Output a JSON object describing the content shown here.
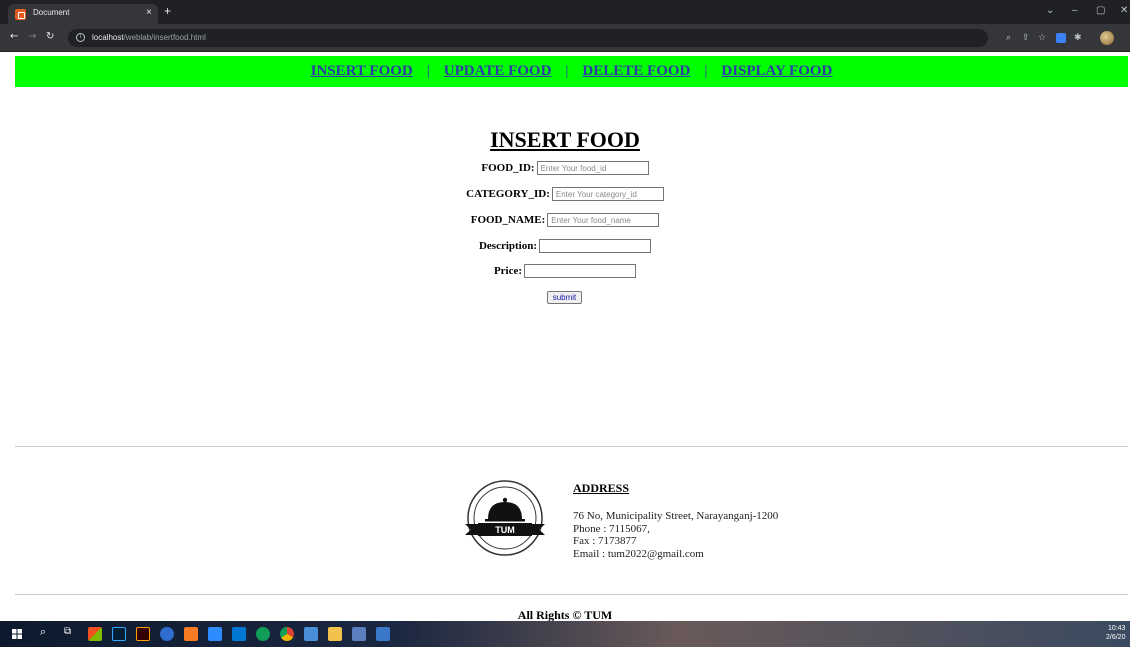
{
  "browser": {
    "tab_title": "Document",
    "tab_close": "×",
    "new_tab": "+",
    "url_host": "localhost",
    "url_path": "/weblab/insertfood.html",
    "window_controls": [
      "⌄",
      "–",
      "▢",
      "✕"
    ]
  },
  "navbar": {
    "links": [
      "INSERT FOOD",
      "UPDATE FOOD",
      "DELETE FOOD",
      "DISPLAY FOOD"
    ],
    "separator": "|"
  },
  "form": {
    "title": "INSERT FOOD",
    "fields": [
      {
        "label": "FOOD_ID:",
        "placeholder": "Enter Your food_id",
        "value": ""
      },
      {
        "label": "CATEGORY_ID:",
        "placeholder": "Enter Your category_id",
        "value": ""
      },
      {
        "label": "FOOD_NAME:",
        "placeholder": "Enter Your food_name",
        "value": ""
      },
      {
        "label": "Description:",
        "placeholder": "",
        "value": ""
      },
      {
        "label": "Price:",
        "placeholder": "",
        "value": ""
      }
    ],
    "submit_label": "submit"
  },
  "footer": {
    "logo_text": "TUM",
    "address_title": "ADDRESS",
    "address_lines": [
      "76 No, Municipality Street, Narayanganj-1200",
      "Phone : 7115067,",
      "Fax : 7173877",
      "Email : tum2022@gmail.com"
    ],
    "copyright": "All Rights © TUM"
  },
  "taskbar": {
    "clock_time": "10:43",
    "clock_date": "2/6/20"
  },
  "colors": {
    "navbar_bg": "#00ff00",
    "link": "#2d3aa8"
  }
}
